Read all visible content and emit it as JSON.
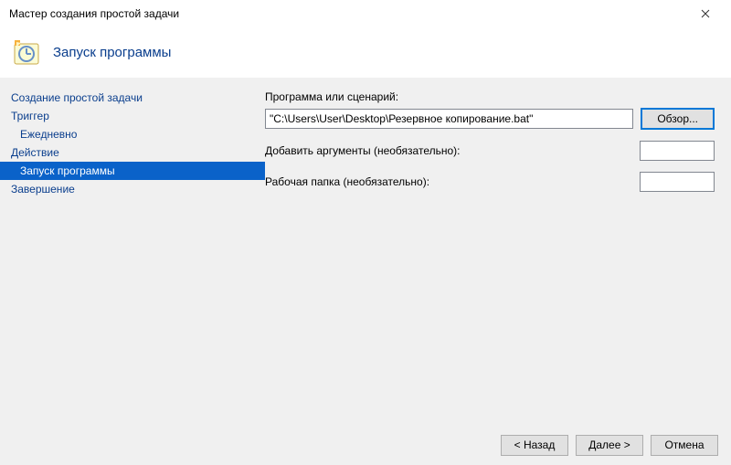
{
  "window": {
    "title": "Мастер создания простой задачи"
  },
  "header": {
    "title": "Запуск программы"
  },
  "sidebar": {
    "items": [
      {
        "label": "Создание простой задачи",
        "sub": false,
        "selected": false
      },
      {
        "label": "Триггер",
        "sub": false,
        "selected": false
      },
      {
        "label": "Ежедневно",
        "sub": true,
        "selected": false
      },
      {
        "label": "Действие",
        "sub": false,
        "selected": false
      },
      {
        "label": "Запуск программы",
        "sub": true,
        "selected": true
      },
      {
        "label": "Завершение",
        "sub": false,
        "selected": false
      }
    ]
  },
  "form": {
    "program_label": "Программа или сценарий:",
    "program_value": "\"C:\\Users\\User\\Desktop\\Резервное копирование.bat\"",
    "browse_label": "Обзор...",
    "args_label": "Добавить аргументы (необязательно):",
    "args_value": "",
    "startin_label": "Рабочая папка (необязательно):",
    "startin_value": ""
  },
  "footer": {
    "back": "< Назад",
    "next": "Далее >",
    "cancel": "Отмена"
  }
}
